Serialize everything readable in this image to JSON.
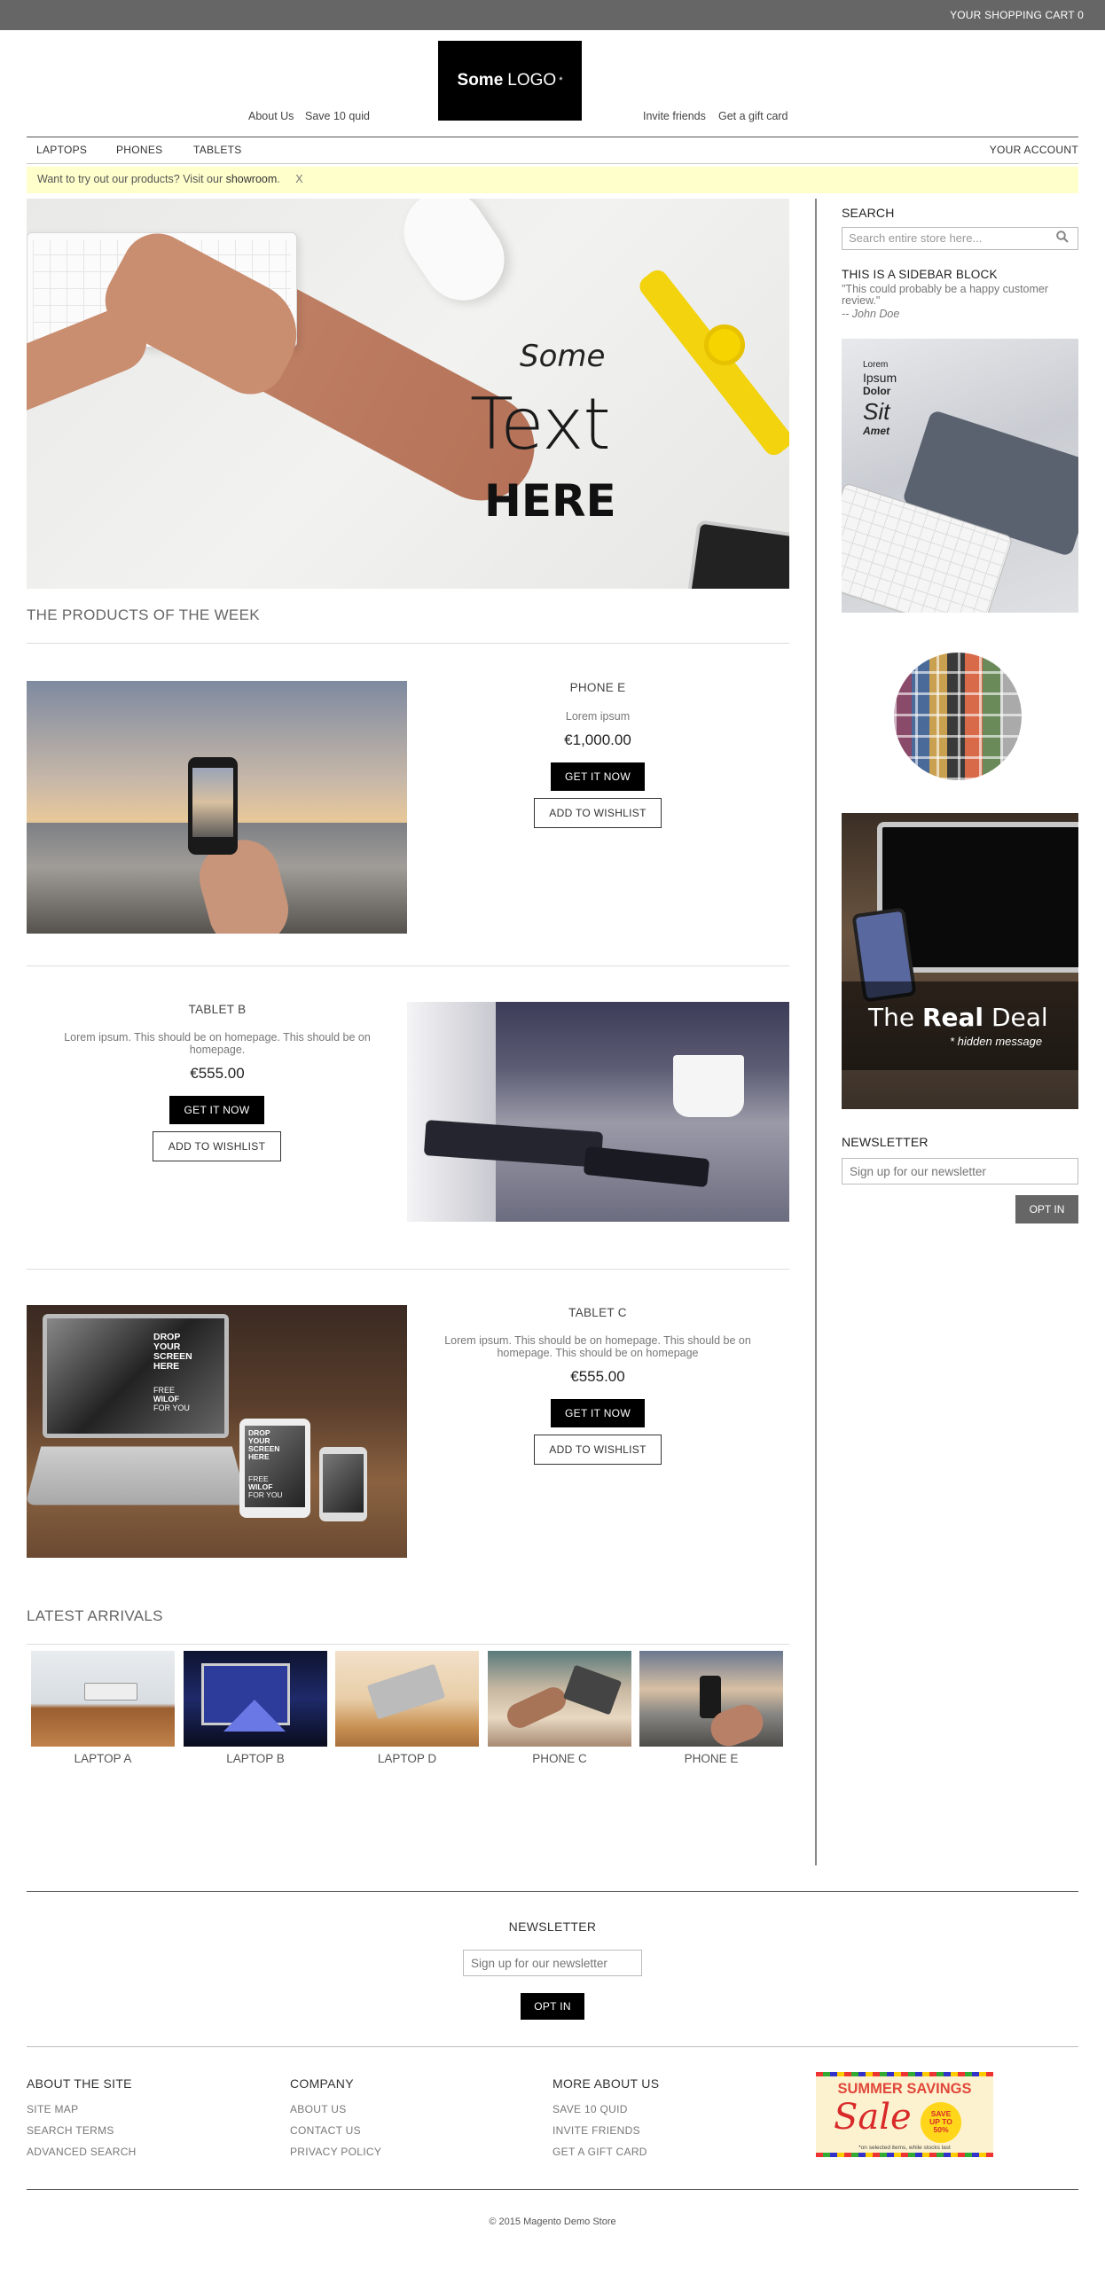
{
  "topbar": {
    "cart": "YOUR SHOPPING CART 0"
  },
  "header": {
    "logo_bold": "Some",
    "logo_text": "LOGO",
    "logo_mark": "*",
    "links_left": [
      "About Us",
      "Save 10 quid"
    ],
    "links_right": [
      "Invite friends",
      "Get a gift card"
    ]
  },
  "nav": {
    "items": [
      "LAPTOPS",
      "PHONES",
      "TABLETS"
    ],
    "account": "YOUR ACCOUNT"
  },
  "notice": {
    "text": "Want to try out our products? Visit our",
    "link": "showroom",
    "end": ".",
    "close": "X"
  },
  "hero": {
    "line1": "Some",
    "line2": "Text",
    "line3": "HERE"
  },
  "products_section": {
    "title": "THE PRODUCTS OF THE WEEK"
  },
  "products": [
    {
      "name": "PHONE E",
      "desc": "Lorem ipsum",
      "price": "€1,000.00",
      "cta": "GET IT NOW",
      "wishlist": "ADD TO WISHLIST"
    },
    {
      "name": "TABLET B",
      "desc": "Lorem ipsum. This should be on homepage. This should be on homepage.",
      "price": "€555.00",
      "cta": "GET IT NOW",
      "wishlist": "ADD TO WISHLIST"
    },
    {
      "name": "TABLET C",
      "desc": "Lorem ipsum. This should be on homepage. This should be on homepage. This should be on homepage",
      "price": "€555.00",
      "cta": "GET IT NOW",
      "wishlist": "ADD TO WISHLIST"
    }
  ],
  "mockup": {
    "screen": [
      "DROP",
      "YOUR",
      "SCREEN",
      "HERE"
    ],
    "free": "FREE",
    "brand": "WILOF",
    "for": "FOR YOU"
  },
  "latest": {
    "title": "LATEST ARRIVALS",
    "items": [
      "LAPTOP A",
      "LAPTOP B",
      "LAPTOP D",
      "PHONE C",
      "PHONE E"
    ]
  },
  "sidebar": {
    "search_title": "SEARCH",
    "search_placeholder": "Search entire store here...",
    "block_title": "THIS IS A SIDEBAR BLOCK",
    "quote": "\"This could probably be a happy customer review.\"",
    "author": "-- John Doe",
    "promo1": [
      "Lorem",
      "Ipsum",
      "Dolor",
      "Sit",
      "Amet"
    ],
    "promo2_prefix": "The",
    "promo2_bold": "Real",
    "promo2_suffix": "Deal",
    "promo2_sub": "* hidden message",
    "newsletter_title": "NEWSLETTER",
    "newsletter_placeholder": "Sign up for our newsletter",
    "newsletter_button": "OPT IN"
  },
  "footer_newsletter": {
    "title": "NEWSLETTER",
    "placeholder": "Sign up for our newsletter",
    "button": "OPT IN"
  },
  "footer": {
    "cols": [
      {
        "title": "ABOUT THE SITE",
        "items": [
          "SITE MAP",
          "SEARCH TERMS",
          "ADVANCED SEARCH"
        ]
      },
      {
        "title": "COMPANY",
        "items": [
          "ABOUT US",
          "CONTACT US",
          "PRIVACY POLICY"
        ]
      },
      {
        "title": "MORE ABOUT US",
        "items": [
          "SAVE 10 QUID",
          "INVITE FRIENDS",
          "GET A GIFT CARD"
        ]
      }
    ],
    "sale": {
      "title": "SUMMER SAVINGS",
      "word": "Sale",
      "badge1": "SAVE",
      "badge2": "UP TO",
      "badge3": "50%",
      "note": "*on selected items, while stocks last"
    },
    "copyright": "© 2015 Magento Demo Store"
  },
  "colors": {
    "topbar": "#666666",
    "notice_bg": "#ffffcc",
    "button": "#000000",
    "sidebar_button": "#666666"
  }
}
